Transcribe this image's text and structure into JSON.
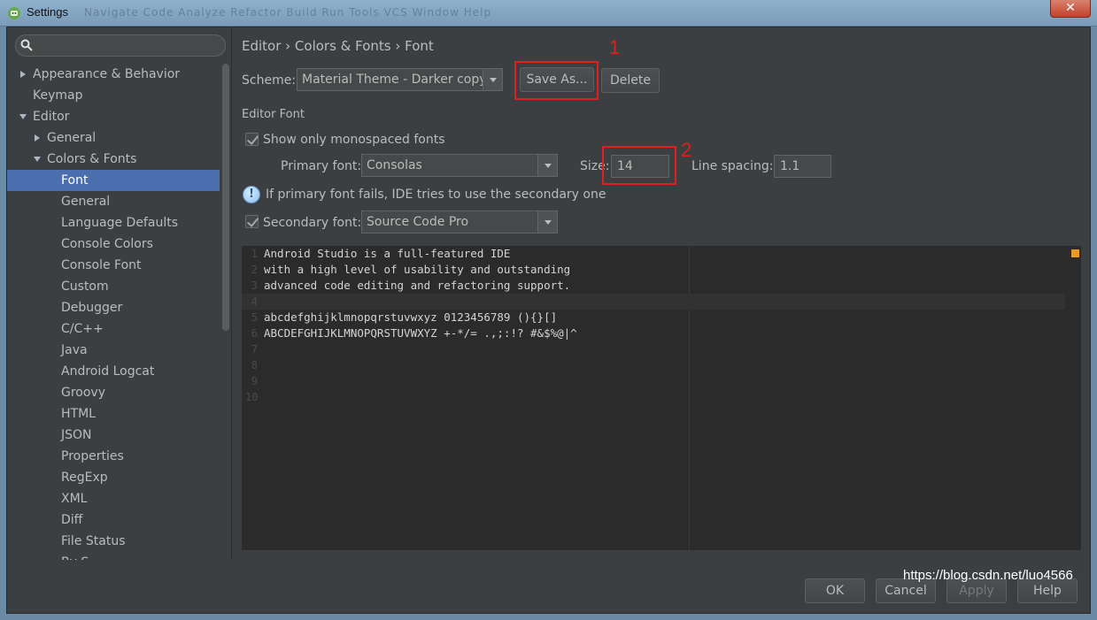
{
  "window": {
    "title": "Settings",
    "menu_ghost": "Navigate  Code  Analyze  Refactor  Build  Run  Tools  VCS  Window  Help",
    "close_label": "✕"
  },
  "sidebar": {
    "search_placeholder": "",
    "items": [
      {
        "label": "Appearance & Behavior"
      },
      {
        "label": "Keymap"
      },
      {
        "label": "Editor"
      },
      {
        "label": "General"
      },
      {
        "label": "Colors & Fonts"
      },
      {
        "label": "Font"
      },
      {
        "label": "General"
      },
      {
        "label": "Language Defaults"
      },
      {
        "label": "Console Colors"
      },
      {
        "label": "Console Font"
      },
      {
        "label": "Custom"
      },
      {
        "label": "Debugger"
      },
      {
        "label": "C/C++"
      },
      {
        "label": "Java"
      },
      {
        "label": "Android Logcat"
      },
      {
        "label": "Groovy"
      },
      {
        "label": "HTML"
      },
      {
        "label": "JSON"
      },
      {
        "label": "Properties"
      },
      {
        "label": "RegExp"
      },
      {
        "label": "XML"
      },
      {
        "label": "Diff"
      },
      {
        "label": "File Status"
      },
      {
        "label": "By S..."
      }
    ]
  },
  "main": {
    "breadcrumb": "Editor › Colors & Fonts › Font",
    "scheme_label": "Scheme:",
    "scheme_value": "Material Theme - Darker copy",
    "save_as_label": "Save As...",
    "delete_label": "Delete",
    "editor_font_heading": "Editor Font",
    "show_mono_label": "Show only monospaced fonts",
    "primary_font_label": "Primary font:",
    "primary_font_value": "Consolas",
    "size_label": "Size:",
    "size_value": "14",
    "line_spacing_label": "Line spacing:",
    "line_spacing_value": "1.1",
    "info_text": "If primary font fails, IDE tries to use the secondary one",
    "info_glyph": "!",
    "secondary_font_label": "Secondary font:",
    "secondary_font_value": "Source Code Pro",
    "annotation_1": "1",
    "annotation_2": "2"
  },
  "preview": {
    "lines": [
      {
        "num": "1",
        "text": "Android Studio is a full-featured IDE"
      },
      {
        "num": "2",
        "text": "with a high level of usability and outstanding"
      },
      {
        "num": "3",
        "text": "advanced code editing and refactoring support."
      },
      {
        "num": "4",
        "text": ""
      },
      {
        "num": "5",
        "text": "abcdefghijklmnopqrstuvwxyz 0123456789 (){}[]"
      },
      {
        "num": "6",
        "text": "ABCDEFGHIJKLMNOPQRSTUVWXYZ +-*/= .,;:!? #&$%@|^"
      },
      {
        "num": "7",
        "text": ""
      },
      {
        "num": "8",
        "text": ""
      },
      {
        "num": "9",
        "text": ""
      },
      {
        "num": "10",
        "text": ""
      }
    ]
  },
  "footer": {
    "ok_label": "OK",
    "cancel_label": "Cancel",
    "apply_label": "Apply",
    "help_label": "Help",
    "watermark": "https://blog.csdn.net/luo4566"
  },
  "colors": {
    "background": "#3c3f41",
    "selection": "#4b6eaf",
    "editor_bg": "#2b2b2b",
    "annotation": "#e0201c"
  }
}
